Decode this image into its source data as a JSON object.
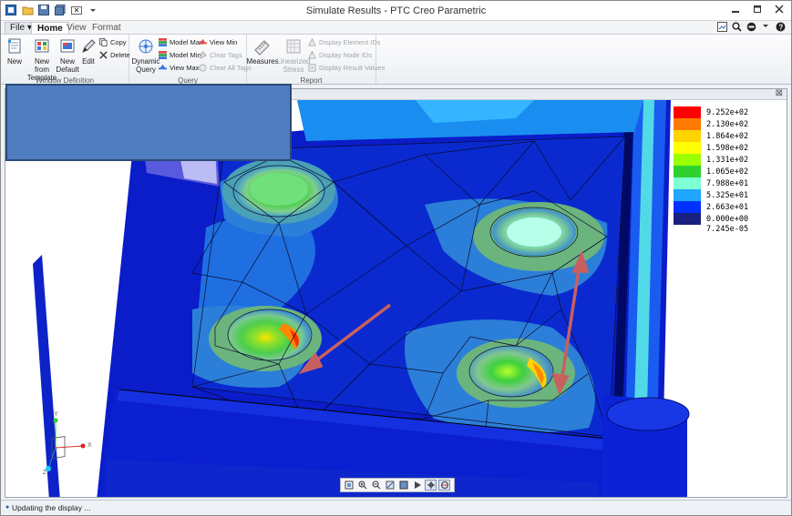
{
  "window": {
    "title": "Simulate Results - PTC Creo Parametric"
  },
  "tabs": {
    "file": "File",
    "home": "Home",
    "view": "View",
    "format": "Format"
  },
  "ribbon": {
    "window_definition": {
      "label": "Window Definition",
      "new": "New",
      "new_from_template": "New from\nTemplate",
      "new_default": "New\nDefault",
      "edit": "Edit",
      "copy": "Copy",
      "delete": "Delete"
    },
    "query": {
      "label": "Query",
      "dynamic_query": "Dynamic\nQuery",
      "model_max": "Model Max",
      "model_min": "Model Min",
      "view_max": "View Max",
      "view_min": "View Min",
      "clear_tags": "Clear Tags",
      "clear_all_tags": "Clear All Tags"
    },
    "report": {
      "label": "Report",
      "measures": "Measures",
      "linearized_stress": "Linearized\nStress",
      "display_element_ids": "Display Element IDs",
      "display_node_ids": "Display Node IDs",
      "display_result_values": "Display Result Values"
    }
  },
  "legend": {
    "values": [
      "9.252e+02",
      "2.130e+02",
      "1.864e+02",
      "1.598e+02",
      "1.331e+02",
      "1.065e+02",
      "7.988e+01",
      "5.325e+01",
      "2.663e+01",
      "0.000e+00"
    ],
    "colors": [
      "#ff0000",
      "#ff7a00",
      "#ffd400",
      "#ffff00",
      "#9aff00",
      "#2fd12f",
      "#7fffd4",
      "#1fa6ff",
      "#0030ff",
      "#1a2080"
    ],
    "min_value": "7.245e-05"
  },
  "triad": {
    "y": "Y",
    "x": "X",
    "z": "Z"
  },
  "status": {
    "text": "Updating the display ..."
  }
}
